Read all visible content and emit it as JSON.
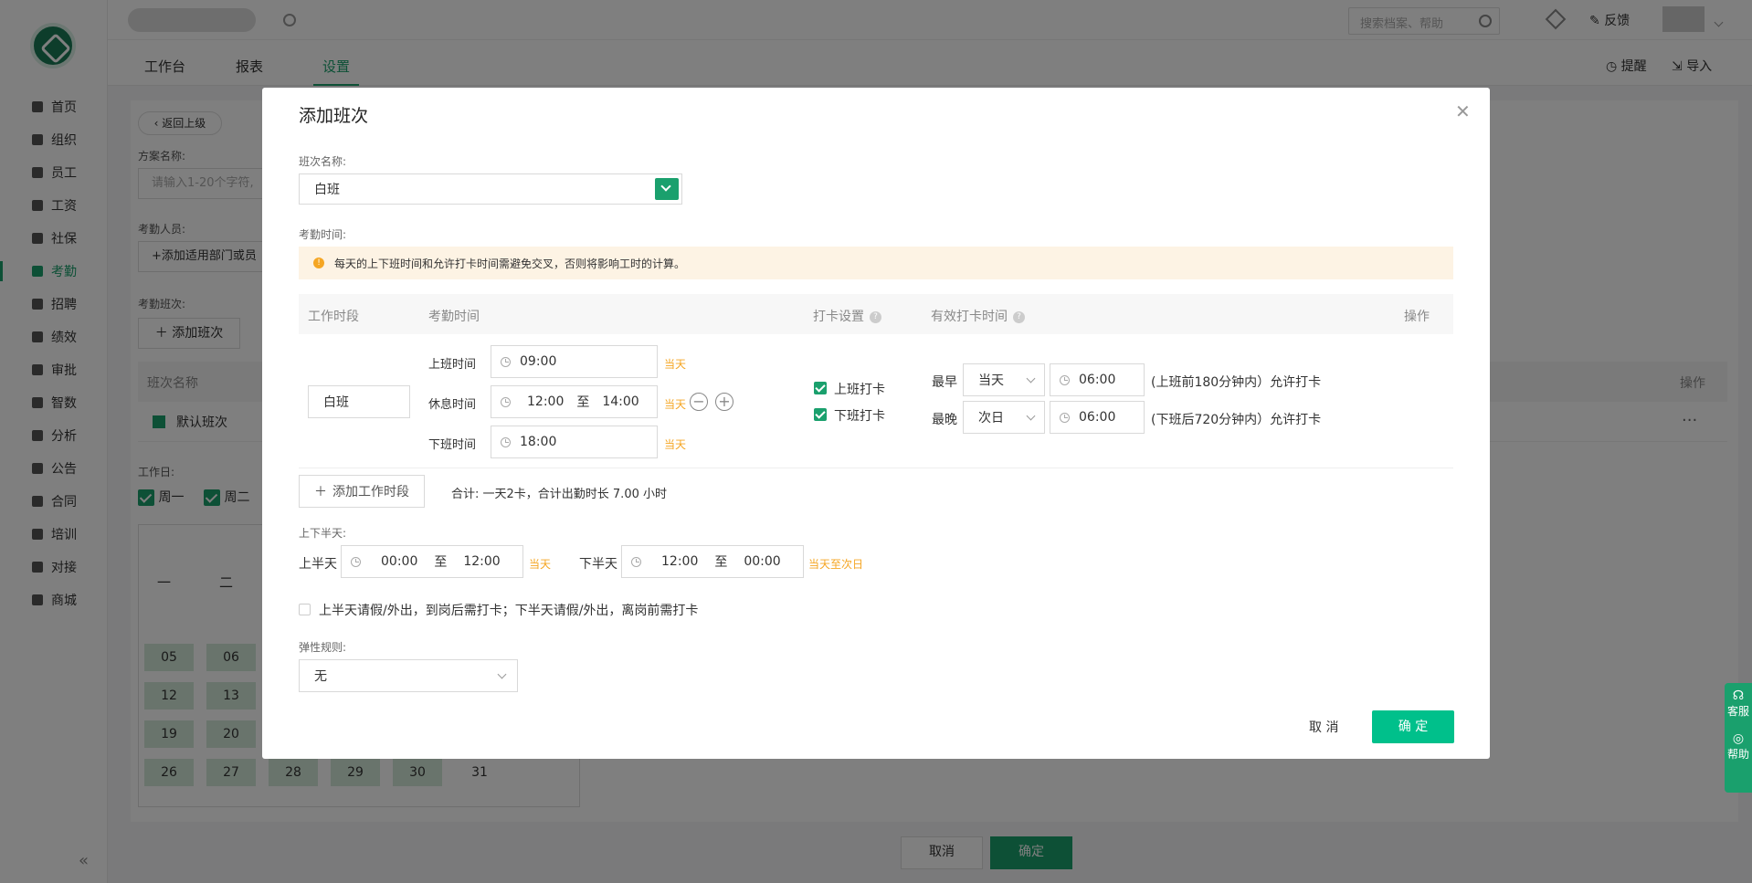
{
  "topbar": {
    "search_placeholder": "搜索档案、帮助",
    "feedback": "反馈"
  },
  "sidebar": {
    "items": [
      {
        "label": "首页"
      },
      {
        "label": "组织"
      },
      {
        "label": "员工"
      },
      {
        "label": "工资"
      },
      {
        "label": "社保"
      },
      {
        "label": "考勤"
      },
      {
        "label": "招聘"
      },
      {
        "label": "绩效"
      },
      {
        "label": "审批"
      },
      {
        "label": "智数"
      },
      {
        "label": "分析"
      },
      {
        "label": "公告"
      },
      {
        "label": "合同"
      },
      {
        "label": "培训"
      },
      {
        "label": "对接"
      },
      {
        "label": "商城"
      }
    ],
    "active_index": 5,
    "collapse_icon": "double-chevron-left-icon"
  },
  "tabs": [
    {
      "label": "工作台"
    },
    {
      "label": "报表"
    },
    {
      "label": "设置"
    }
  ],
  "tab_actions": {
    "remind": "提醒",
    "import": "导入"
  },
  "page": {
    "back_label": "返回上级",
    "scheme_name_label": "方案名称:",
    "scheme_name_placeholder": "请输入1-20个字符,",
    "staff_label": "考勤人员:",
    "staff_add": "+添加适用部门或员",
    "shift_label": "考勤班次:",
    "add_shift": "添加班次",
    "table_header_shift": "班次名称",
    "table_header_op": "操作",
    "default_shift": "默认班次",
    "workday_label": "工作日:",
    "workdays": [
      "周一",
      "周二"
    ],
    "cal_header": [
      "一",
      "二"
    ],
    "cal_rows": [
      [
        "05",
        "06"
      ],
      [
        "12",
        "13"
      ],
      [
        "19",
        "20"
      ],
      [
        "26",
        "27",
        "28",
        "29",
        "30",
        "31"
      ]
    ],
    "cancel": "取消",
    "confirm": "确定",
    "more_icon": "ellipsis-icon"
  },
  "side_widget": {
    "service": "客服",
    "help": "帮助"
  },
  "modal": {
    "title": "添加班次",
    "name_label": "班次名称:",
    "name_value": "白班",
    "time_label": "考勤时间:",
    "warning": "每天的上下班时间和允许打卡时间需避免交叉，否则将影响工时的计算。",
    "headers": {
      "period": "工作时段",
      "time": "考勤时间",
      "punch": "打卡设置",
      "valid": "有效打卡时间",
      "op": "操作"
    },
    "period_name": "白班",
    "on_label": "上班时间",
    "on_time": "09:00",
    "break_label": "休息时间",
    "break_start": "12:00",
    "break_to": "至",
    "break_end": "14:00",
    "off_label": "下班时间",
    "off_time": "18:00",
    "same_day": "当天",
    "punch_on": "上班打卡",
    "punch_off": "下班打卡",
    "earliest_label": "最早",
    "earliest_day": "当天",
    "earliest_time": "06:00",
    "earliest_note": "(上班前180分钟内）允许打卡",
    "latest_label": "最晚",
    "latest_day": "次日",
    "latest_time": "06:00",
    "latest_note": "(下班后720分钟内）允许打卡",
    "add_period": "添加工作时段",
    "total": "合计: 一天2卡，合计出勤时长 7.00 小时",
    "halfday_label": "上下半天:",
    "first_half_label": "上半天",
    "first_half_start": "00:00",
    "first_half_end": "12:00",
    "first_half_day": "当天",
    "second_half_label": "下半天",
    "second_half_start": "12:00",
    "second_half_end": "00:00",
    "second_half_day": "当天至次日",
    "leave_rule": "上半天请假/外出，到岗后需打卡；下半天请假/外出，离岗前需打卡",
    "flex_label": "弹性规则:",
    "flex_value": "无",
    "cancel": "取 消",
    "ok": "确 定"
  },
  "colors": {
    "accent": "#1aa06d",
    "warning_text": "#f5a623",
    "warning_bg": "#fdf3e4",
    "overlay": "rgba(0,0,0,0.5)"
  }
}
